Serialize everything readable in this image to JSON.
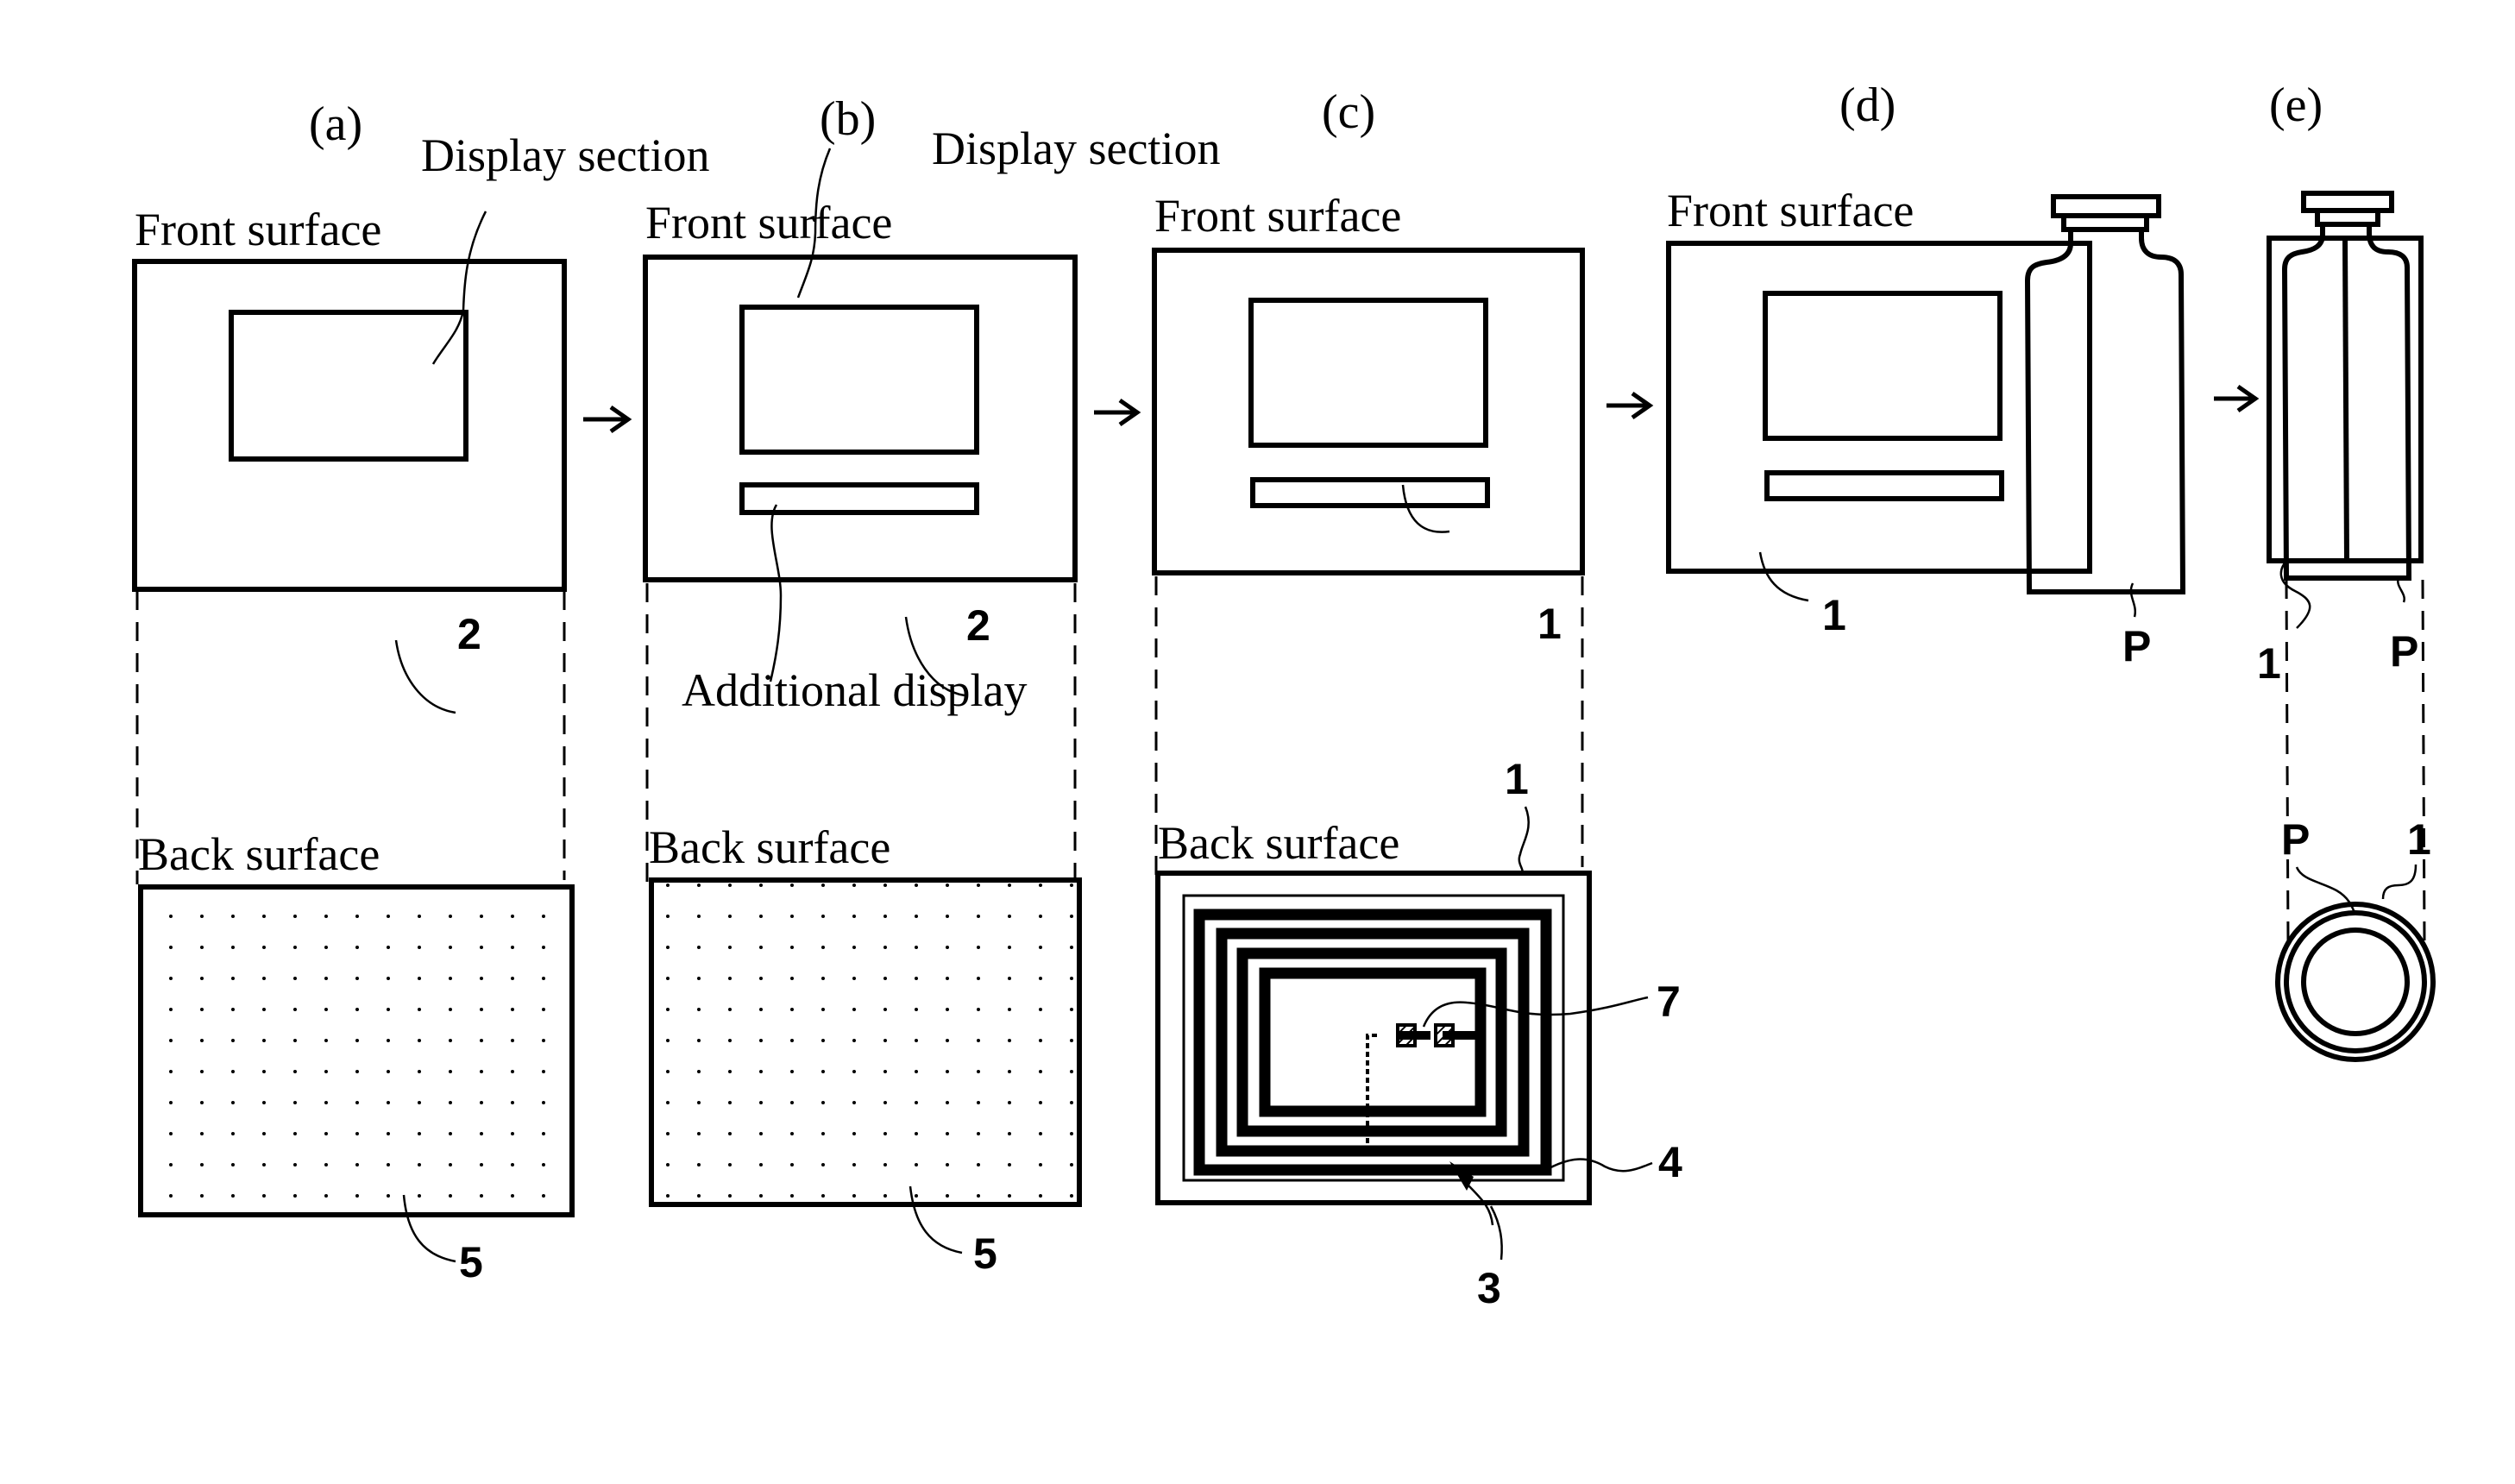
{
  "figure": {
    "panels": [
      {
        "id": "a",
        "caption": "(a)"
      },
      {
        "id": "b",
        "caption": "(b)"
      },
      {
        "id": "c",
        "caption": "(c)"
      },
      {
        "id": "d",
        "caption": "(d)"
      },
      {
        "id": "e",
        "caption": "(e)"
      }
    ],
    "labels": {
      "front_surface": "Front surface",
      "back_surface": "Back surface",
      "display_section": "Display section",
      "additional_display": "Additional display"
    },
    "reference_numerals": {
      "label_base_blank": "2",
      "label": "1",
      "ic_tag_antenna": "3",
      "base_sheet": "4",
      "adhesive_layer": "5",
      "ic_chip": "7",
      "container": "P"
    }
  }
}
